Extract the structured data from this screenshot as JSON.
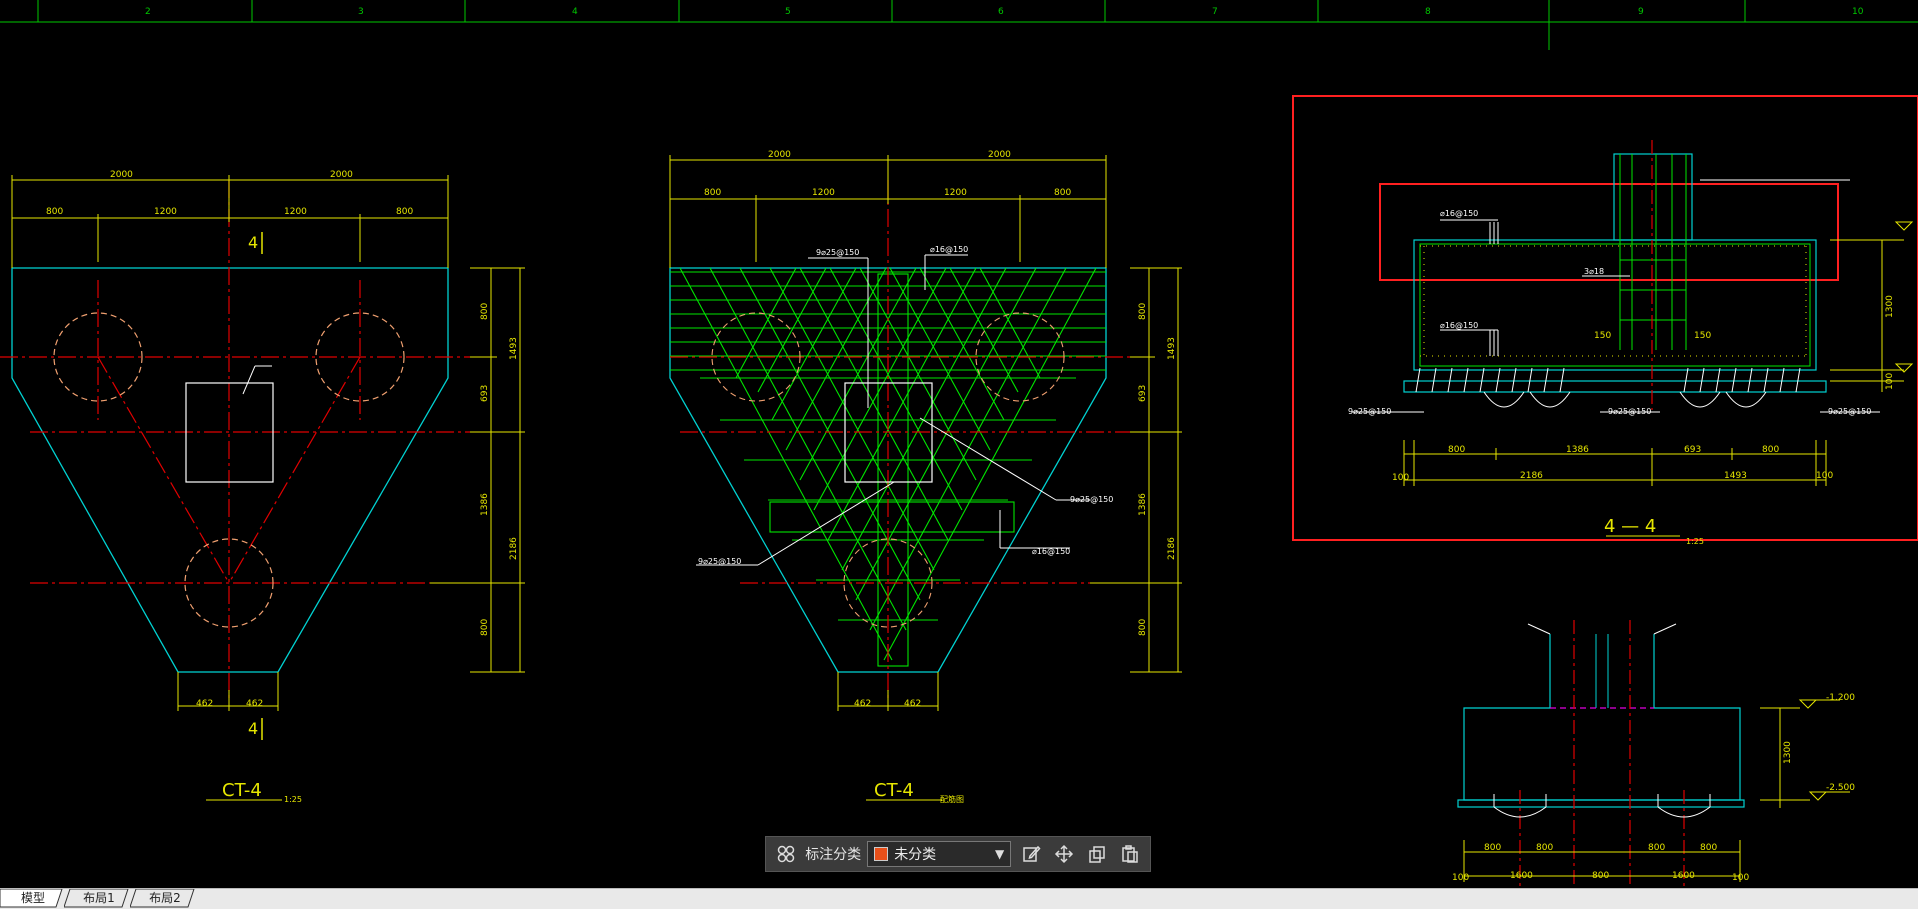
{
  "ruler": {
    "labels": [
      "2",
      "3",
      "4",
      "5",
      "6",
      "7",
      "8",
      "9",
      "10"
    ]
  },
  "drawing": {
    "left": {
      "dims_top": [
        "2000",
        "2000"
      ],
      "dims_sub": [
        "800",
        "1200",
        "1200",
        "800"
      ],
      "dims_right": [
        "800",
        "693",
        "1386",
        "800",
        "1493",
        "2186"
      ],
      "dims_bottom": [
        "462",
        "462"
      ],
      "section_mark": "4",
      "title": "CT-4",
      "scale": "1:25"
    },
    "middle": {
      "dims_top": [
        "2000",
        "2000"
      ],
      "dims_sub": [
        "800",
        "1200",
        "1200",
        "800"
      ],
      "dims_right": [
        "800",
        "693",
        "1386",
        "800",
        "1493",
        "2186"
      ],
      "dims_bottom": [
        "462",
        "462"
      ],
      "rebar_labels": [
        "9⌀25@150",
        "⌀16@150",
        "9⌀25@150",
        "9⌀25@150",
        "⌀16@150"
      ],
      "title": "CT-4",
      "subtitle": "配筋图"
    },
    "section": {
      "labels_left": [
        "⌀16@150",
        "3⌀18",
        "⌀16@150"
      ],
      "labels_bottom": [
        "9⌀25@150",
        "9⌀25@150",
        "9⌀25@150"
      ],
      "dims_bottom_row1": [
        "800",
        "1386",
        "693",
        "800"
      ],
      "dims_bottom_row2": [
        "100",
        "2186",
        "1493",
        "100"
      ],
      "dims_right": [
        "1300",
        "100"
      ],
      "side_marks": [
        "150",
        "150"
      ],
      "title": "4 — 4",
      "scale": "1:25"
    },
    "lower": {
      "elevations": [
        "-1.200",
        "-2.500"
      ],
      "dims_right": [
        "1300"
      ],
      "dims_row1": [
        "800",
        "800",
        "800",
        "800"
      ],
      "dims_row2": [
        "100",
        "1600",
        "800",
        "1600",
        "100"
      ]
    }
  },
  "toolbar": {
    "label": "标注分类",
    "selected": "未分类",
    "swatch_color": "#e8501a",
    "icons": [
      "grid-icon",
      "edit-icon",
      "move-icon",
      "copy-icon",
      "paste-icon"
    ]
  },
  "tabs": [
    "模型",
    "布局1",
    "布局2"
  ],
  "colors": {
    "background": "#000000",
    "outline": "#00d2d2",
    "dimension": "#e6e600",
    "centerline": "#e00000",
    "rebar": "#00e600",
    "highlight": "#ff2020",
    "ruler": "#00c800"
  }
}
